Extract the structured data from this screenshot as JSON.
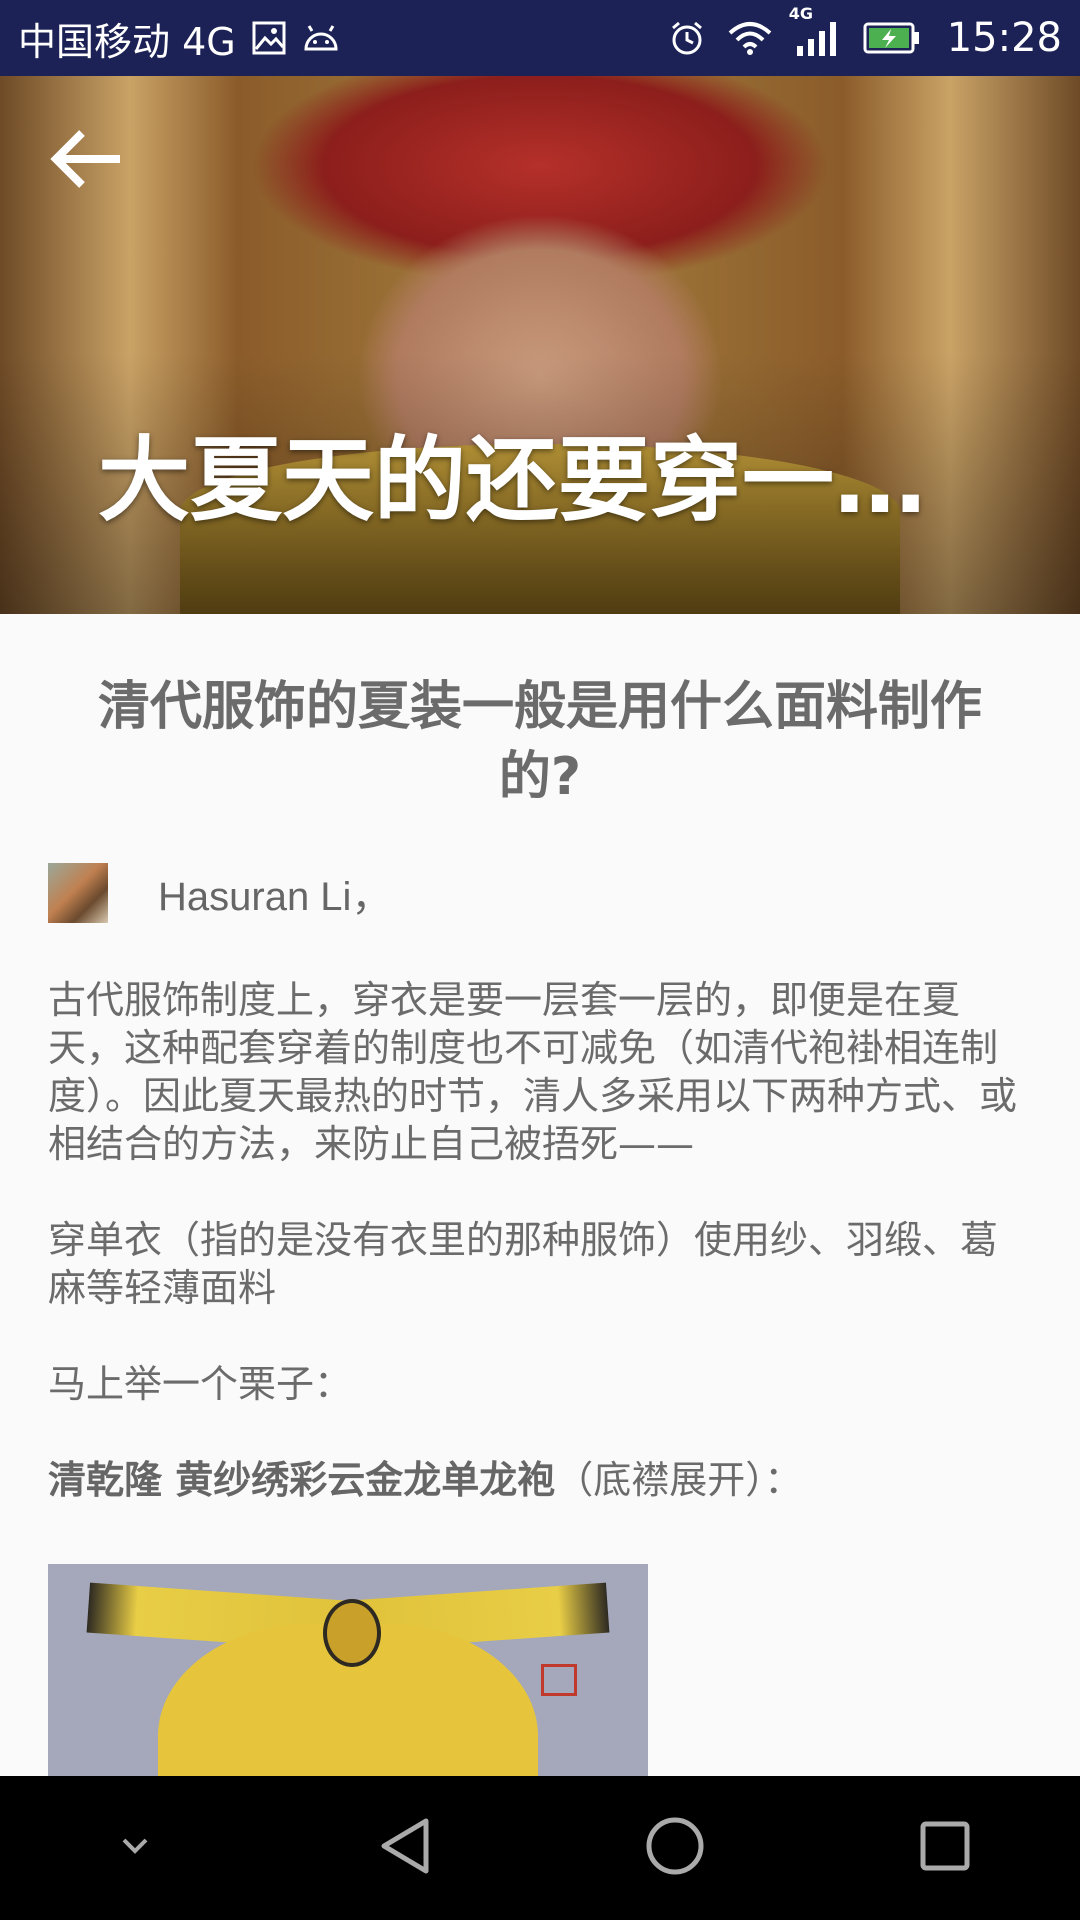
{
  "status_bar": {
    "carrier": "中国移动 4G",
    "network_badge": "4G",
    "time": "15:28",
    "icons": [
      "image-icon",
      "android-icon",
      "alarm-icon",
      "wifi-icon",
      "signal-icon",
      "battery-charging-icon"
    ]
  },
  "hero": {
    "title": "大夏天的还要穿一…",
    "back_icon": "arrow-left-icon"
  },
  "article": {
    "question_title": "清代服饰的夏装一般是用什么面料制作的?",
    "author_name": "Hasuran Li，",
    "paragraph_1": "古代服饰制度上，穿衣是要一层套一层的，即便是在夏天，这种配套穿着的制度也不可减免（如清代袍褂相连制度）。因此夏天最热的时节，清人多采用以下两种方式、或相结合的方法，来防止自己被捂死——",
    "paragraph_2": "穿单衣（指的是没有衣里的那种服饰）使用纱、羽缎、葛麻等轻薄面料",
    "paragraph_3": "马上举一个栗子：",
    "paragraph_4_bold": "清乾隆 黄纱绣彩云金龙单龙袍",
    "paragraph_4_rest": "（底襟展开）："
  },
  "nav_bar": {
    "icons": [
      "collapse-chevron-icon",
      "back-triangle-icon",
      "home-circle-icon",
      "recents-square-icon"
    ]
  }
}
